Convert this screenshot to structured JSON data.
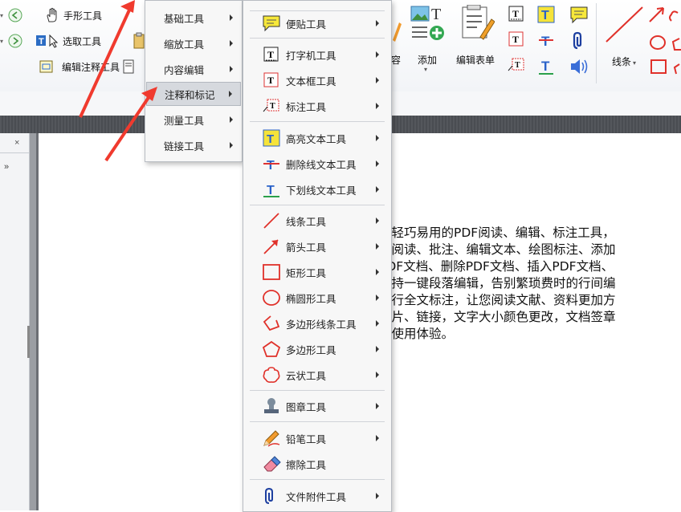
{
  "ribbon": {
    "hand_tool": "手形工具",
    "select_tool": "选取工具",
    "edit_annotation_tool": "编辑注释工具",
    "content_label": "容",
    "add_label": "添加",
    "edit_form_label": "编辑表单",
    "lines_label": "线条"
  },
  "menu_primary": {
    "items": [
      {
        "label": "基础工具",
        "active": false
      },
      {
        "label": "缩放工具",
        "active": false
      },
      {
        "label": "内容编辑",
        "active": false
      },
      {
        "label": "注释和标记",
        "active": true
      },
      {
        "label": "测量工具",
        "active": false
      },
      {
        "label": "链接工具",
        "active": false
      }
    ]
  },
  "menu_secondary": {
    "items": [
      {
        "label": "便贴工具",
        "icon": "sticky-note-icon"
      },
      {
        "label": "打字机工具",
        "icon": "typewriter-icon"
      },
      {
        "label": "文本框工具",
        "icon": "textbox-icon"
      },
      {
        "label": "标注工具",
        "icon": "callout-icon"
      },
      {
        "label": "高亮文本工具",
        "icon": "highlight-text-icon"
      },
      {
        "label": "删除线文本工具",
        "icon": "strikethrough-text-icon"
      },
      {
        "label": "下划线文本工具",
        "icon": "underline-text-icon"
      },
      {
        "label": "线条工具",
        "icon": "line-icon"
      },
      {
        "label": "箭头工具",
        "icon": "arrow-icon"
      },
      {
        "label": "矩形工具",
        "icon": "rectangle-icon"
      },
      {
        "label": "椭圆形工具",
        "icon": "ellipse-icon"
      },
      {
        "label": "多边形线条工具",
        "icon": "polyline-icon"
      },
      {
        "label": "多边形工具",
        "icon": "polygon-icon"
      },
      {
        "label": "云状工具",
        "icon": "cloud-icon"
      },
      {
        "label": "图章工具",
        "icon": "stamp-icon"
      },
      {
        "label": "铅笔工具",
        "icon": "pencil-icon"
      },
      {
        "label": "擦除工具",
        "icon": "eraser-icon"
      },
      {
        "label": "文件附件工具",
        "icon": "paperclip-icon"
      }
    ]
  },
  "document": {
    "lines": [
      "欢轻巧易用的PDF阅读、编辑、标注工具，",
      "、阅读、批注、编辑文本、绘图标注、添加",
      "PDF文档、删除PDF文档、插入PDF文档、",
      "支持一键段落编辑，告别繁琐费时的行间编",
      "进行全文标注，让您阅读文献、资料更加方",
      "图片、链接，文字大小颜色更改，文档签章",
      "的使用体验。"
    ]
  },
  "colors": {
    "annotation_arrow": "#f03a2e",
    "menu_active": "#d6d9de",
    "accent_blue": "#1f6fd1"
  }
}
